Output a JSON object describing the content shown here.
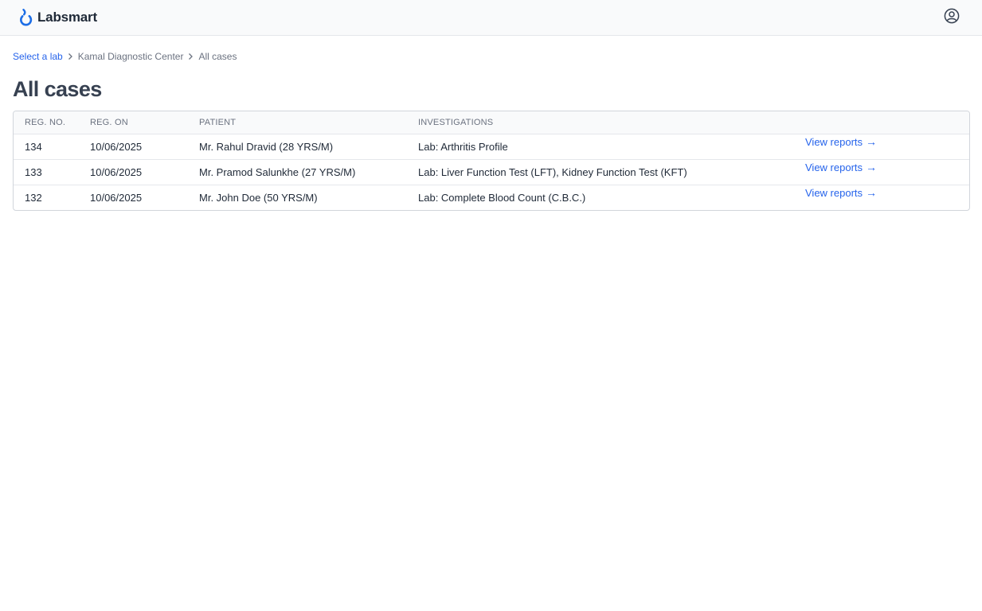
{
  "header": {
    "brand_name": "Labsmart",
    "brand_color": "#1d6ee6"
  },
  "breadcrumb": {
    "items": [
      {
        "label": "Select a lab"
      },
      {
        "label": "Kamal Diagnostic Center"
      },
      {
        "label": "All cases"
      }
    ]
  },
  "page": {
    "title": "All cases"
  },
  "table": {
    "columns": [
      "REG. NO.",
      "REG. ON",
      "PATIENT",
      "INVESTIGATIONS",
      ""
    ],
    "rows": [
      {
        "reg_no": "134",
        "reg_on": "10/06/2025",
        "patient": "Mr. Rahul Dravid (28 YRS/M)",
        "investigations": "Lab: Arthritis Profile",
        "action": "View reports"
      },
      {
        "reg_no": "133",
        "reg_on": "10/06/2025",
        "patient": "Mr. Pramod Salunkhe (27 YRS/M)",
        "investigations": "Lab: Liver Function Test (LFT), Kidney Function Test (KFT)",
        "action": "View reports"
      },
      {
        "reg_no": "132",
        "reg_on": "10/06/2025",
        "patient": "Mr. John Doe (50 YRS/M)",
        "investigations": "Lab: Complete Blood Count (C.B.C.)",
        "action": "View reports"
      }
    ],
    "arrow_glyph": "→"
  },
  "icons": {
    "logo": "labsmart-logo-icon",
    "account": "user-circle-icon",
    "breadcrumb_separator": "chevron-right-icon",
    "row_action": "arrow-right-icon"
  }
}
